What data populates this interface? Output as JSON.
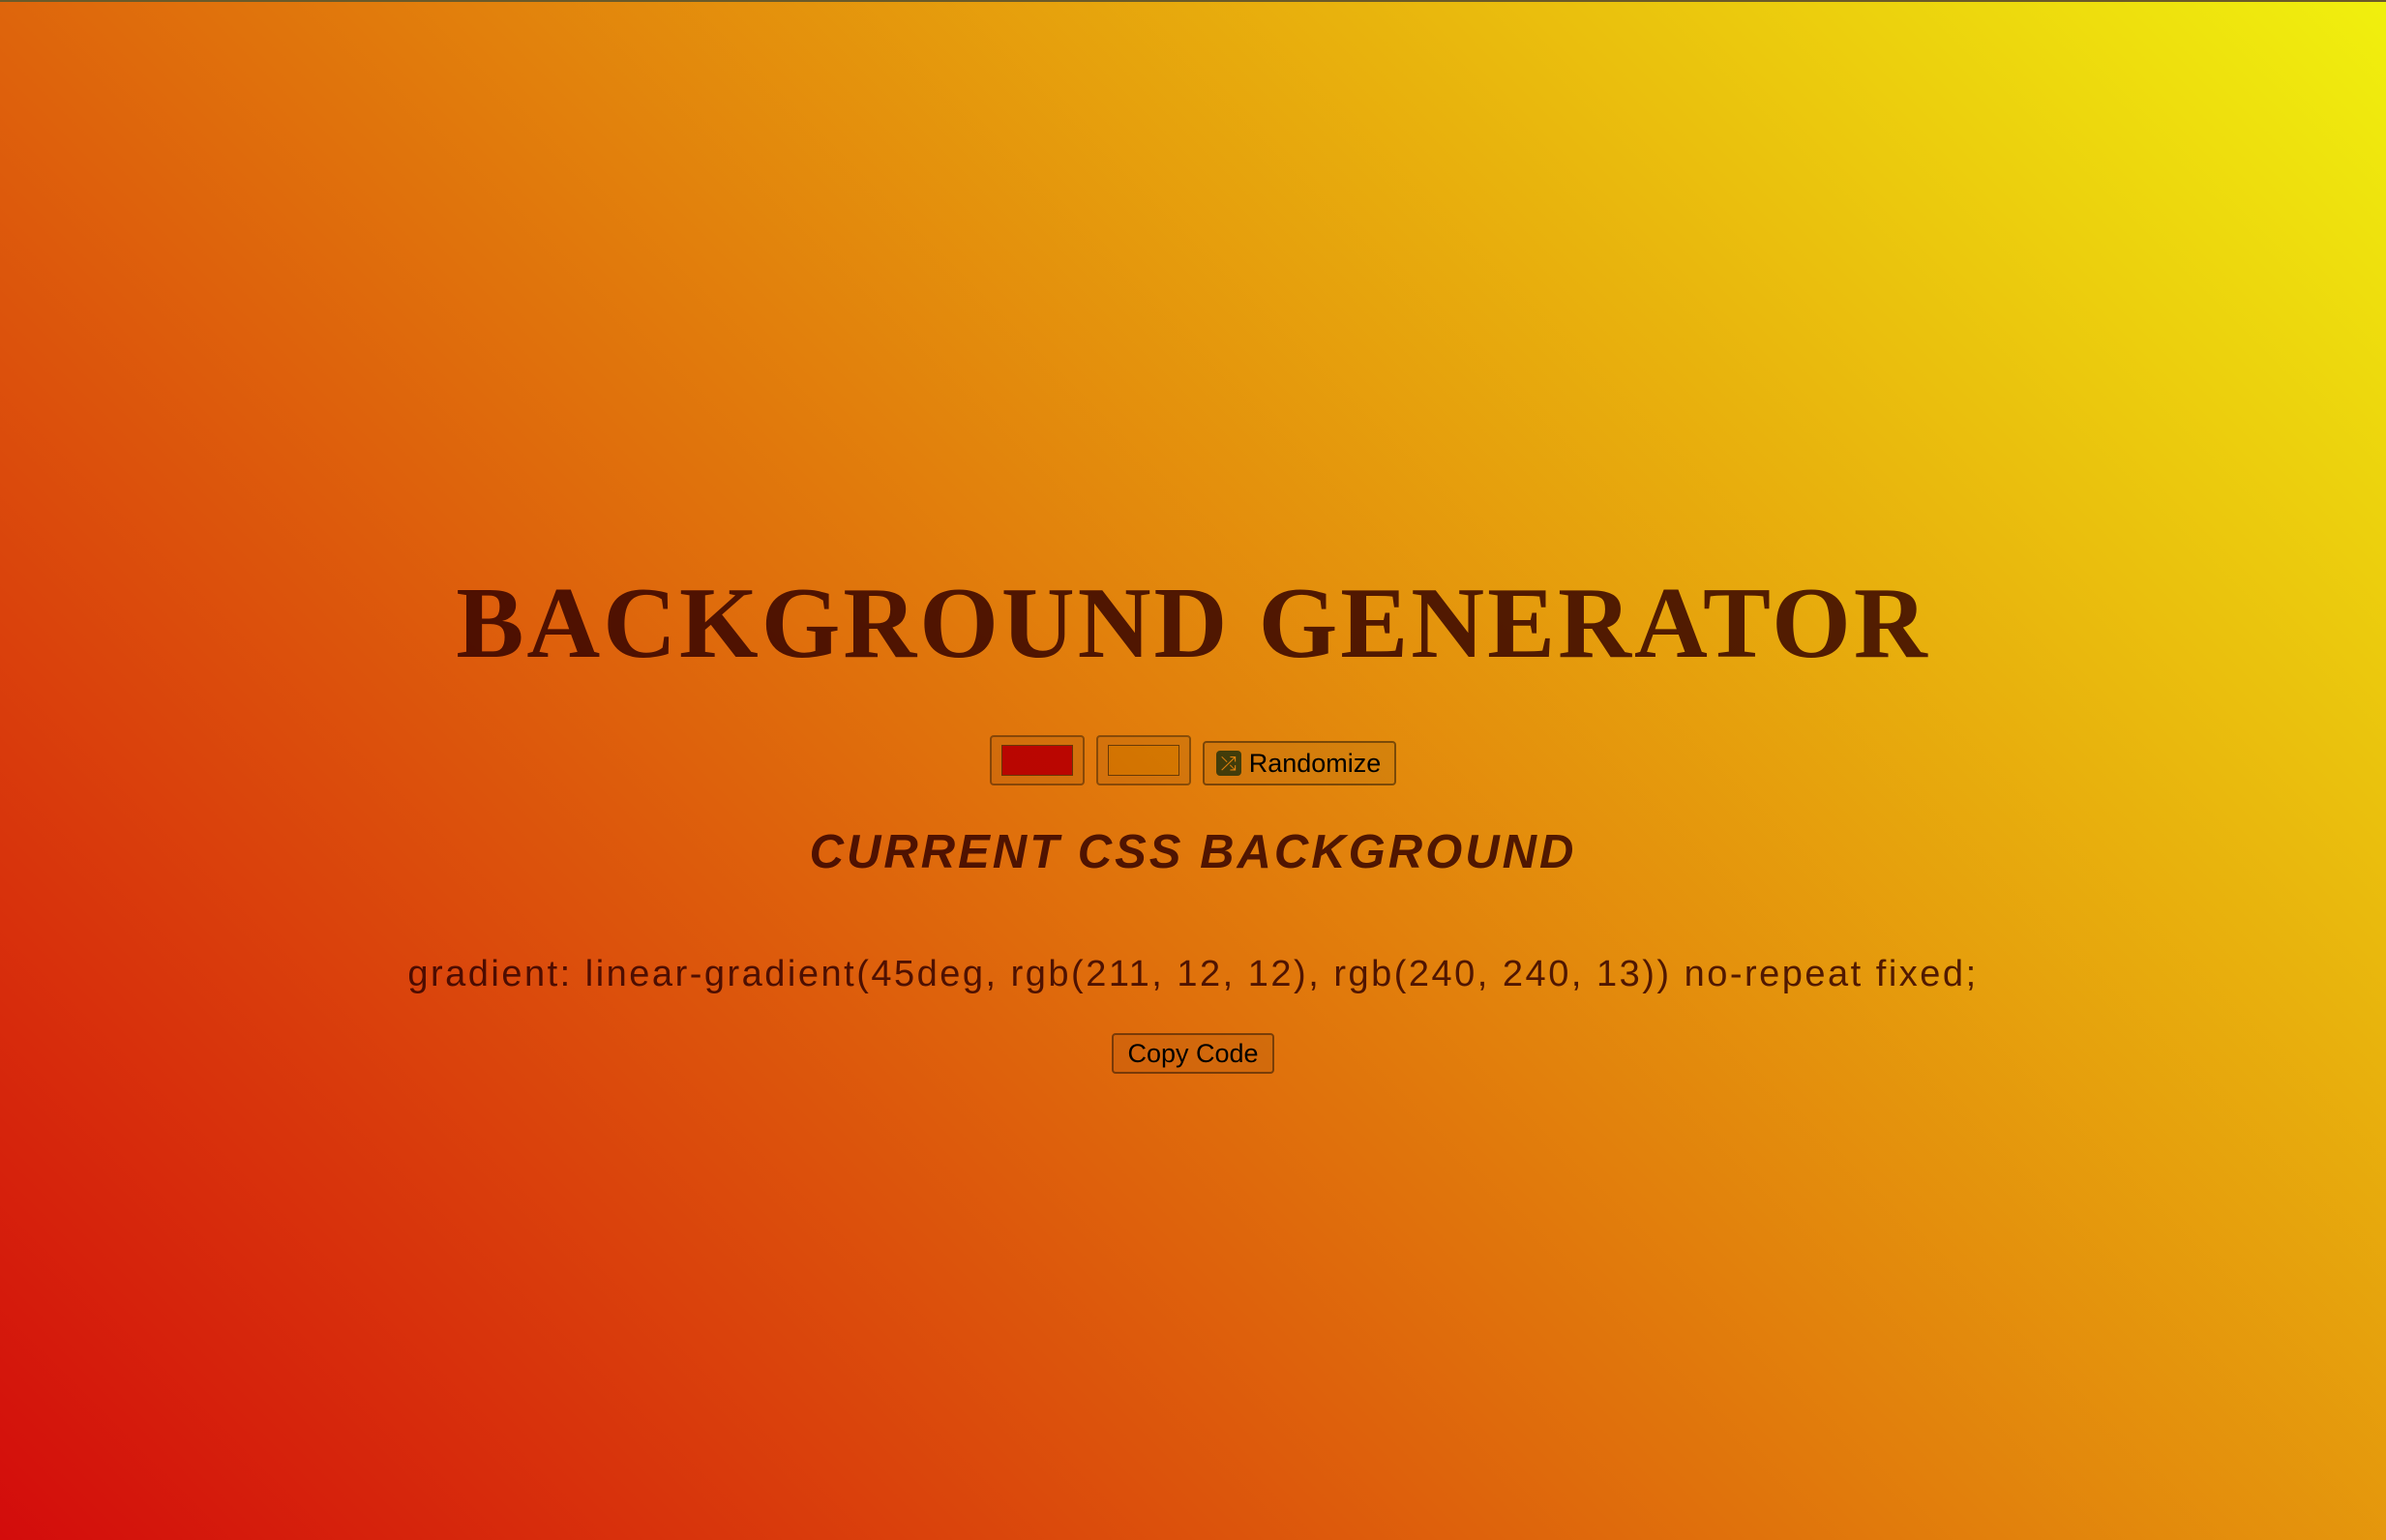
{
  "page": {
    "title": "BACKGROUND GENERATOR",
    "subtitle": "CURRENT CSS BACKGROUND",
    "css_output": "gradient: linear-gradient(45deg, rgb(211, 12, 12), rgb(240, 240, 13)) no-repeat fixed;"
  },
  "controls": {
    "color1": {
      "value": "#d30c0c",
      "icon": "color-swatch"
    },
    "color2": {
      "value": "#f0f00d",
      "icon": "color-swatch"
    },
    "randomize": {
      "label": "Randomize",
      "icon": "shuffle-icon",
      "icon_glyph": "⤮"
    },
    "copy": {
      "label": "Copy Code"
    }
  },
  "colors": {
    "gradient_start": "#d30c0c",
    "gradient_end": "#f0f00d",
    "text": "#5a2a08"
  }
}
